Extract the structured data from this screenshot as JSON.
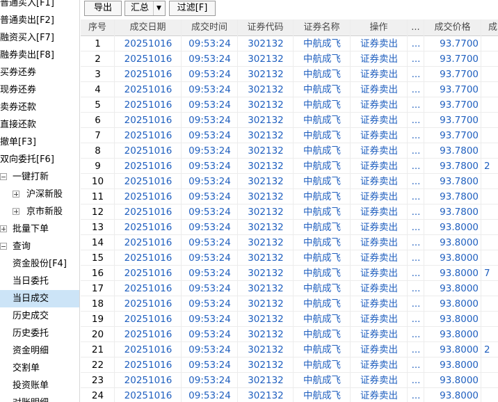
{
  "sidebar": {
    "items": [
      {
        "label": "普通买入[F1]",
        "level": 0,
        "toggle": "",
        "selected": false
      },
      {
        "label": "普通卖出[F2]",
        "level": 0,
        "toggle": "",
        "selected": false
      },
      {
        "label": "融资买入[F7]",
        "level": 0,
        "toggle": "",
        "selected": false
      },
      {
        "label": "融券卖出[F8]",
        "level": 0,
        "toggle": "",
        "selected": false
      },
      {
        "label": "买券还券",
        "level": 0,
        "toggle": "",
        "selected": false
      },
      {
        "label": "现券还券",
        "level": 0,
        "toggle": "",
        "selected": false
      },
      {
        "label": "卖券还款",
        "level": 0,
        "toggle": "",
        "selected": false
      },
      {
        "label": "直接还款",
        "level": 0,
        "toggle": "",
        "selected": false
      },
      {
        "label": "撤单[F3]",
        "level": 0,
        "toggle": "",
        "selected": false
      },
      {
        "label": "双向委托[F6]",
        "level": 0,
        "toggle": "",
        "selected": false
      },
      {
        "label": "一键打新",
        "level": 1,
        "toggle": "minus",
        "selected": false
      },
      {
        "label": "沪深新股",
        "level": 2,
        "toggle": "plus",
        "selected": false
      },
      {
        "label": "京市新股",
        "level": 2,
        "toggle": "plus",
        "selected": false
      },
      {
        "label": "批量下单",
        "level": 1,
        "toggle": "plus",
        "selected": false
      },
      {
        "label": "查询",
        "level": 1,
        "toggle": "minus",
        "selected": false
      },
      {
        "label": "资金股份[F4]",
        "level": 1,
        "toggle": "",
        "selected": false
      },
      {
        "label": "当日委托",
        "level": 1,
        "toggle": "",
        "selected": false
      },
      {
        "label": "当日成交",
        "level": 1,
        "toggle": "",
        "selected": true
      },
      {
        "label": "历史成交",
        "level": 1,
        "toggle": "",
        "selected": false
      },
      {
        "label": "历史委托",
        "level": 1,
        "toggle": "",
        "selected": false
      },
      {
        "label": "资金明细",
        "level": 1,
        "toggle": "",
        "selected": false
      },
      {
        "label": "交割单",
        "level": 1,
        "toggle": "",
        "selected": false
      },
      {
        "label": "投资账单",
        "level": 1,
        "toggle": "",
        "selected": false
      },
      {
        "label": "对账明细",
        "level": 1,
        "toggle": "",
        "selected": false
      }
    ]
  },
  "toolbar": {
    "export_label": "导出",
    "summary_label": "汇总",
    "filter_label": "过滤[F]",
    "dropdown_glyph": "▼"
  },
  "grid": {
    "headers": [
      "序号",
      "成交日期",
      "成交时间",
      "证券代码",
      "证券名称",
      "操作",
      "...",
      "成交价格",
      "成"
    ],
    "rows": [
      {
        "seq": "1",
        "date": "20251016",
        "time": "09:53:24",
        "code": "302132",
        "name": "中航成飞",
        "op": "证券卖出",
        "more": "...",
        "price": "93.7700",
        "extra": ""
      },
      {
        "seq": "2",
        "date": "20251016",
        "time": "09:53:24",
        "code": "302132",
        "name": "中航成飞",
        "op": "证券卖出",
        "more": "...",
        "price": "93.7700",
        "extra": ""
      },
      {
        "seq": "3",
        "date": "20251016",
        "time": "09:53:24",
        "code": "302132",
        "name": "中航成飞",
        "op": "证券卖出",
        "more": "...",
        "price": "93.7700",
        "extra": ""
      },
      {
        "seq": "4",
        "date": "20251016",
        "time": "09:53:24",
        "code": "302132",
        "name": "中航成飞",
        "op": "证券卖出",
        "more": "...",
        "price": "93.7700",
        "extra": ""
      },
      {
        "seq": "5",
        "date": "20251016",
        "time": "09:53:24",
        "code": "302132",
        "name": "中航成飞",
        "op": "证券卖出",
        "more": "...",
        "price": "93.7700",
        "extra": ""
      },
      {
        "seq": "6",
        "date": "20251016",
        "time": "09:53:24",
        "code": "302132",
        "name": "中航成飞",
        "op": "证券卖出",
        "more": "...",
        "price": "93.7700",
        "extra": ""
      },
      {
        "seq": "7",
        "date": "20251016",
        "time": "09:53:24",
        "code": "302132",
        "name": "中航成飞",
        "op": "证券卖出",
        "more": "...",
        "price": "93.7700",
        "extra": ""
      },
      {
        "seq": "8",
        "date": "20251016",
        "time": "09:53:24",
        "code": "302132",
        "name": "中航成飞",
        "op": "证券卖出",
        "more": "...",
        "price": "93.7800",
        "extra": ""
      },
      {
        "seq": "9",
        "date": "20251016",
        "time": "09:53:24",
        "code": "302132",
        "name": "中航成飞",
        "op": "证券卖出",
        "more": "...",
        "price": "93.7800",
        "extra": "2"
      },
      {
        "seq": "10",
        "date": "20251016",
        "time": "09:53:24",
        "code": "302132",
        "name": "中航成飞",
        "op": "证券卖出",
        "more": "...",
        "price": "93.7800",
        "extra": ""
      },
      {
        "seq": "11",
        "date": "20251016",
        "time": "09:53:24",
        "code": "302132",
        "name": "中航成飞",
        "op": "证券卖出",
        "more": "...",
        "price": "93.7800",
        "extra": ""
      },
      {
        "seq": "12",
        "date": "20251016",
        "time": "09:53:24",
        "code": "302132",
        "name": "中航成飞",
        "op": "证券卖出",
        "more": "...",
        "price": "93.7800",
        "extra": ""
      },
      {
        "seq": "13",
        "date": "20251016",
        "time": "09:53:24",
        "code": "302132",
        "name": "中航成飞",
        "op": "证券卖出",
        "more": "...",
        "price": "93.8000",
        "extra": ""
      },
      {
        "seq": "14",
        "date": "20251016",
        "time": "09:53:24",
        "code": "302132",
        "name": "中航成飞",
        "op": "证券卖出",
        "more": "...",
        "price": "93.8000",
        "extra": ""
      },
      {
        "seq": "15",
        "date": "20251016",
        "time": "09:53:24",
        "code": "302132",
        "name": "中航成飞",
        "op": "证券卖出",
        "more": "...",
        "price": "93.8000",
        "extra": ""
      },
      {
        "seq": "16",
        "date": "20251016",
        "time": "09:53:24",
        "code": "302132",
        "name": "中航成飞",
        "op": "证券卖出",
        "more": "...",
        "price": "93.8000",
        "extra": "7"
      },
      {
        "seq": "17",
        "date": "20251016",
        "time": "09:53:24",
        "code": "302132",
        "name": "中航成飞",
        "op": "证券卖出",
        "more": "...",
        "price": "93.8000",
        "extra": ""
      },
      {
        "seq": "18",
        "date": "20251016",
        "time": "09:53:24",
        "code": "302132",
        "name": "中航成飞",
        "op": "证券卖出",
        "more": "...",
        "price": "93.8000",
        "extra": ""
      },
      {
        "seq": "19",
        "date": "20251016",
        "time": "09:53:24",
        "code": "302132",
        "name": "中航成飞",
        "op": "证券卖出",
        "more": "...",
        "price": "93.8000",
        "extra": ""
      },
      {
        "seq": "20",
        "date": "20251016",
        "time": "09:53:24",
        "code": "302132",
        "name": "中航成飞",
        "op": "证券卖出",
        "more": "...",
        "price": "93.8000",
        "extra": ""
      },
      {
        "seq": "21",
        "date": "20251016",
        "time": "09:53:24",
        "code": "302132",
        "name": "中航成飞",
        "op": "证券卖出",
        "more": "...",
        "price": "93.8000",
        "extra": "2"
      },
      {
        "seq": "22",
        "date": "20251016",
        "time": "09:53:24",
        "code": "302132",
        "name": "中航成飞",
        "op": "证券卖出",
        "more": "...",
        "price": "93.8000",
        "extra": ""
      },
      {
        "seq": "23",
        "date": "20251016",
        "time": "09:53:24",
        "code": "302132",
        "name": "中航成飞",
        "op": "证券卖出",
        "more": "...",
        "price": "93.8000",
        "extra": ""
      },
      {
        "seq": "24",
        "date": "20251016",
        "time": "09:53:24",
        "code": "302132",
        "name": "中航成飞",
        "op": "证券卖出",
        "more": "...",
        "price": "93.8000",
        "extra": ""
      }
    ]
  },
  "colors": {
    "cell_text_blue": "#1f5fbf",
    "selected_row_bg": "#cce4f7",
    "header_bg": "#f0f0f0"
  }
}
